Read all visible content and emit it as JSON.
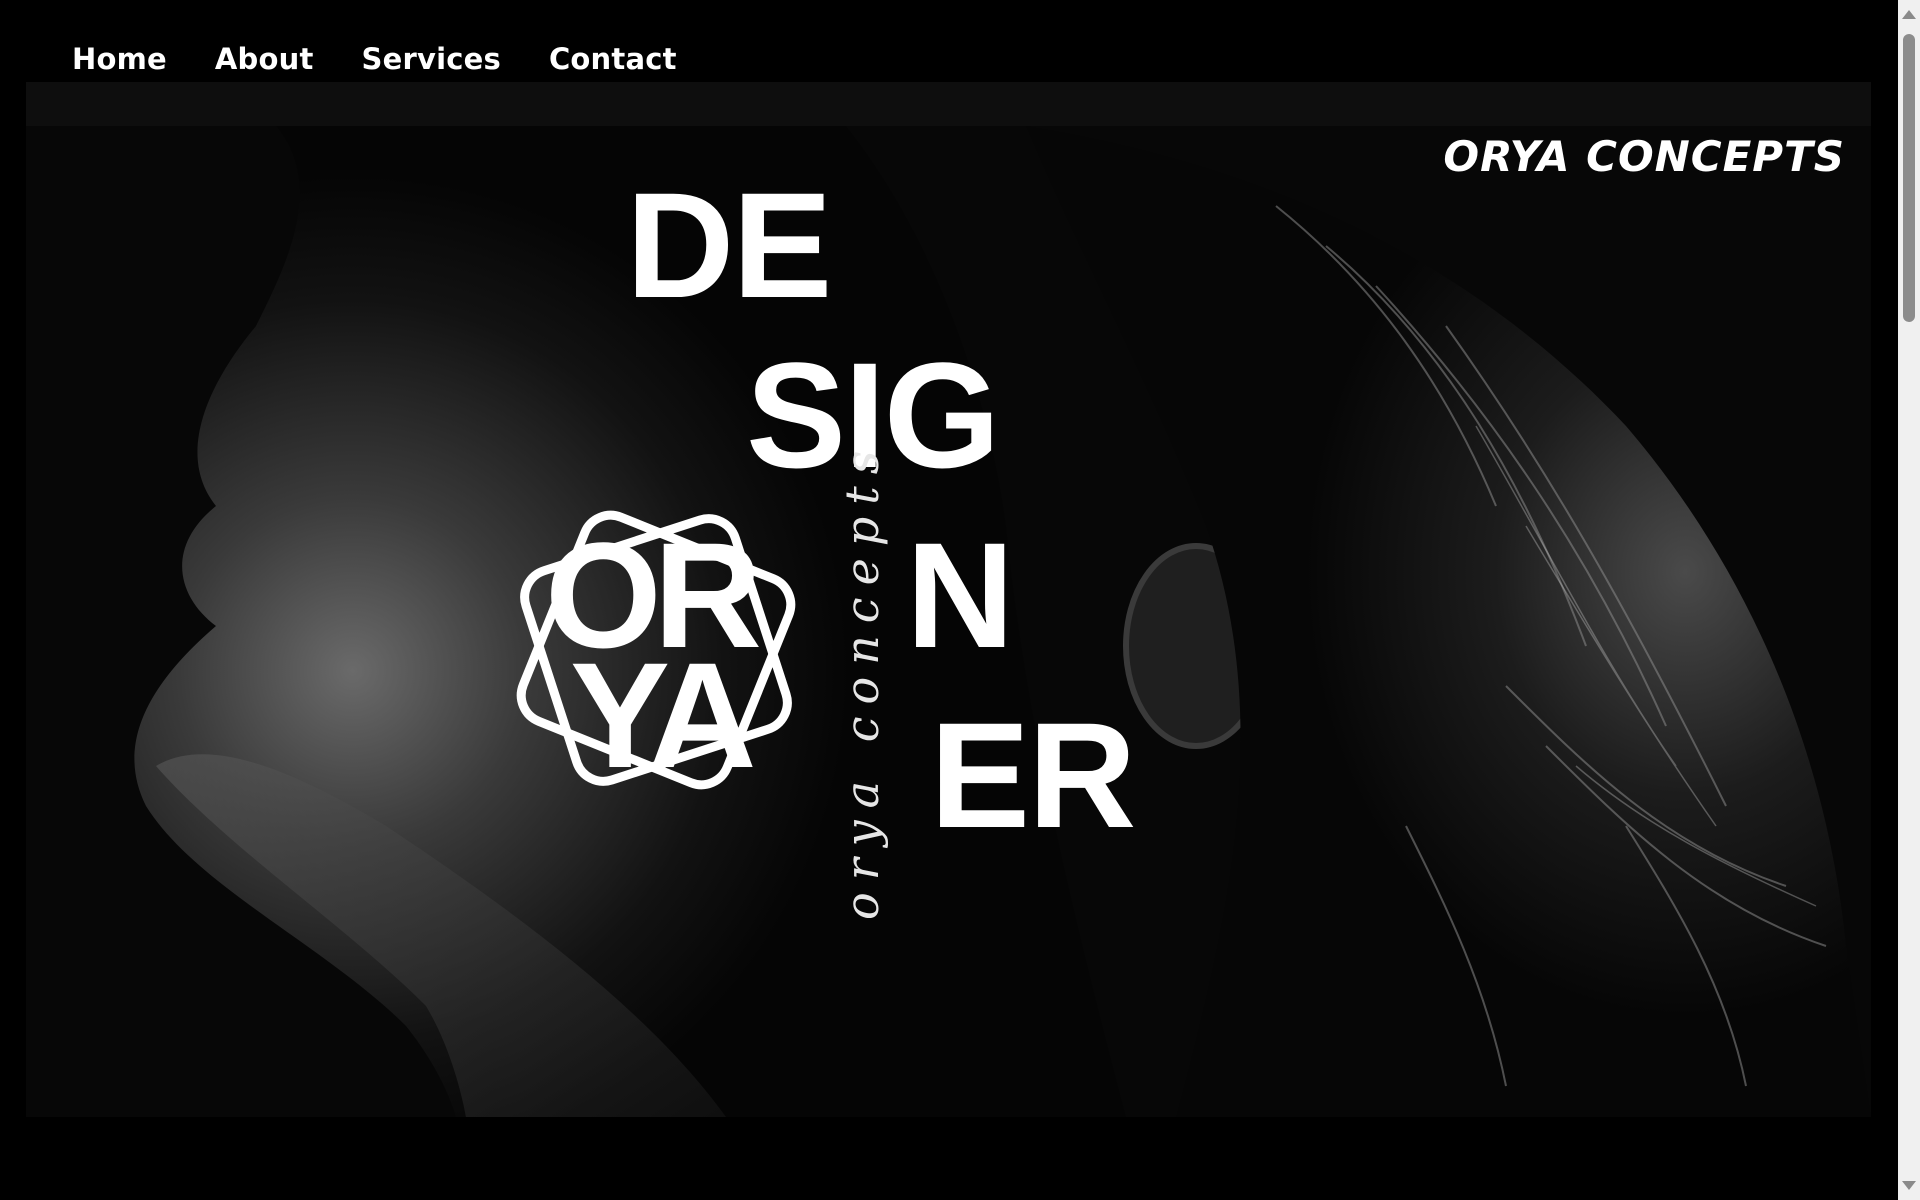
{
  "nav": {
    "items": [
      {
        "label": "Home"
      },
      {
        "label": "About"
      },
      {
        "label": "Services"
      },
      {
        "label": "Contact"
      }
    ]
  },
  "hero": {
    "brand": "ORYA CONCEPTS",
    "headline_parts": [
      "DE",
      "SIG",
      "N",
      "ER"
    ],
    "logo_lines": [
      "OR",
      "YA"
    ],
    "script_text": "orya concepts"
  },
  "colors": {
    "background": "#000000",
    "text": "#ffffff",
    "scrollbar_track": "#f0f0f0",
    "scrollbar_thumb": "#8c8c8c"
  }
}
